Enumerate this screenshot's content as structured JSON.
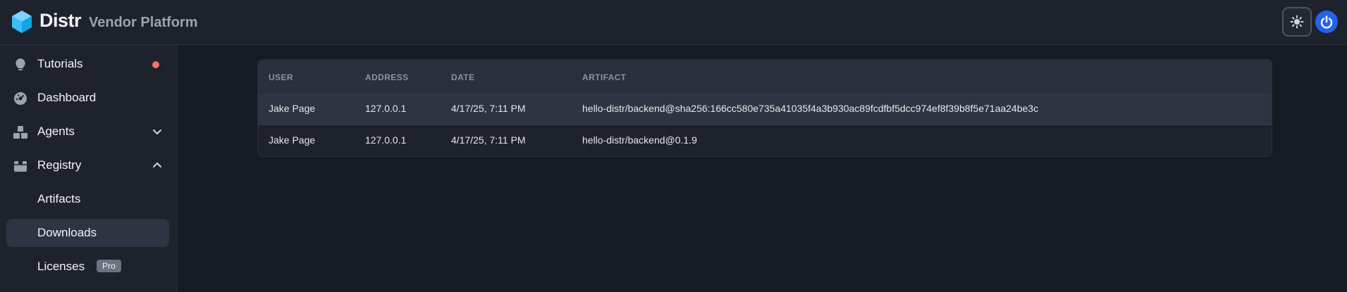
{
  "header": {
    "brand": "Distr",
    "subtitle": "Vendor Platform",
    "theme_icon": "sun-icon",
    "avatar_icon": "power-icon"
  },
  "sidebar": {
    "items": [
      {
        "label": "Tutorials",
        "icon": "lightbulb-icon",
        "notification": true
      },
      {
        "label": "Dashboard",
        "icon": "dashboard-gauge-icon"
      },
      {
        "label": "Agents",
        "icon": "cubes-icon",
        "expanded": false
      },
      {
        "label": "Registry",
        "icon": "box-icon",
        "expanded": true
      }
    ],
    "registry_children": [
      {
        "label": "Artifacts"
      },
      {
        "label": "Downloads",
        "active": true
      },
      {
        "label": "Licenses",
        "badge": "Pro"
      }
    ]
  },
  "table": {
    "columns": [
      "USER",
      "ADDRESS",
      "DATE",
      "ARTIFACT"
    ],
    "rows": [
      {
        "user": "Jake Page",
        "address": "127.0.0.1",
        "date": "4/17/25, 7:11 PM",
        "artifact": "hello-distr/backend@sha256:166cc580e735a41035f4a3b930ac89fcdfbf5dcc974ef8f39b8f5e71aa24be3c"
      },
      {
        "user": "Jake Page",
        "address": "127.0.0.1",
        "date": "4/17/25, 7:11 PM",
        "artifact": "hello-distr/backend@0.1.9"
      }
    ]
  },
  "colors": {
    "background": "#161a23",
    "panel": "#1e222c",
    "accent": "#2563eb",
    "notification": "#f87171"
  }
}
